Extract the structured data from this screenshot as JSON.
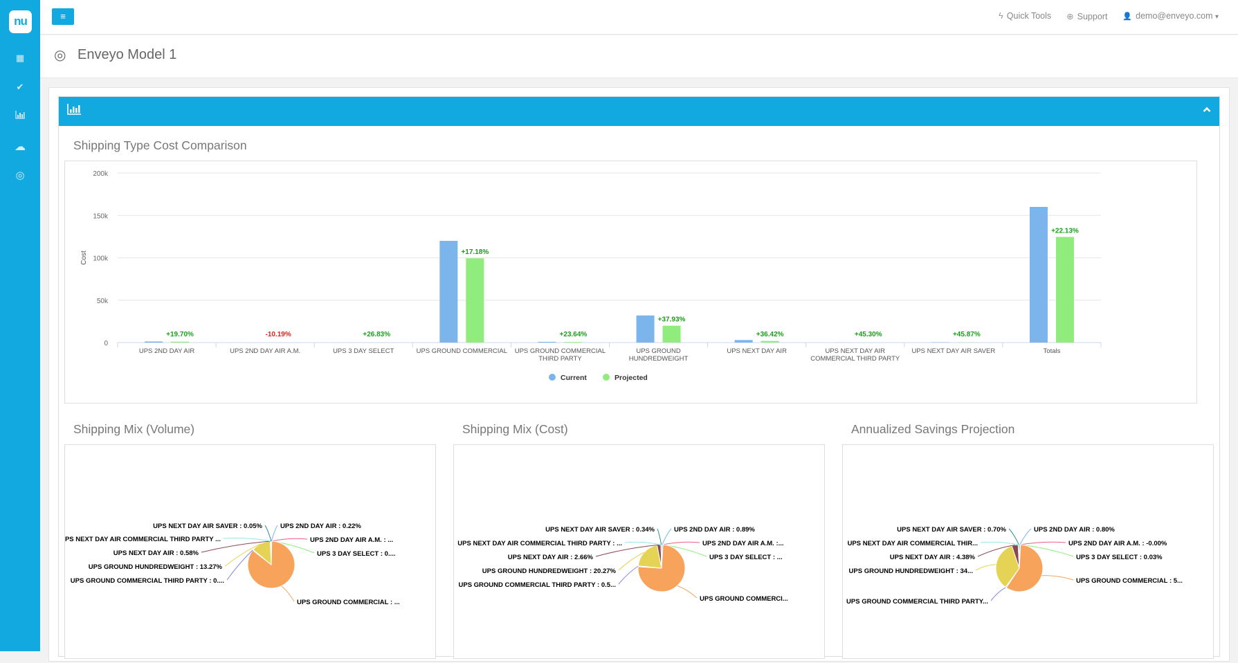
{
  "sidebar": {
    "logo": "nu",
    "items": [
      {
        "name": "dashboard",
        "icon": "grid-icon",
        "glyph": "▦"
      },
      {
        "name": "tasks",
        "icon": "check-icon",
        "glyph": "✔"
      },
      {
        "name": "reports",
        "icon": "bar-chart-icon",
        "glyph": "📊"
      },
      {
        "name": "cloud",
        "icon": "cloud-icon",
        "glyph": "☁"
      },
      {
        "name": "models",
        "icon": "target-icon",
        "glyph": "◎"
      }
    ]
  },
  "topbar": {
    "menu_glyph": "≡",
    "quick_tools": "Quick Tools",
    "support": "Support",
    "user": "demo@enveyo.com",
    "bolt_glyph": "ϟ",
    "support_glyph": "⊕",
    "user_glyph": "👤",
    "caret_glyph": "▾"
  },
  "page": {
    "title": "Enveyo Model 1",
    "title_glyph": "◎"
  },
  "panel": {
    "header_glyph": "📊",
    "collapse_glyph": "⌃"
  },
  "colors": {
    "brand": "#11a9e0",
    "current": "#7cb5ec",
    "projected": "#90ed7d",
    "positive_label": "#1a9e1a",
    "negative_label": "#e02020",
    "pie": [
      "#7cb5ec",
      "#f15c80",
      "#90ed7d",
      "#f7a35c",
      "#8085e9",
      "#e4d354",
      "#8d4653",
      "#91e8e1",
      "#2b908f"
    ]
  },
  "chart_data": [
    {
      "type": "bar",
      "title": "Shipping Type Cost Comparison",
      "xlabel": "",
      "ylabel": "Cost",
      "ylim": [
        0,
        200000
      ],
      "yticks": [
        "0",
        "50k",
        "100k",
        "150k",
        "200k"
      ],
      "grid": true,
      "legend": "bottom-center",
      "categories": [
        [
          "UPS 2ND DAY AIR"
        ],
        [
          "UPS 2ND DAY AIR A.M."
        ],
        [
          "UPS 3 DAY SELECT"
        ],
        [
          "UPS GROUND COMMERCIAL"
        ],
        [
          "UPS GROUND COMMERCIAL",
          "THIRD PARTY"
        ],
        [
          "UPS GROUND",
          "HUNDREDWEIGHT"
        ],
        [
          "UPS NEXT DAY AIR"
        ],
        [
          "UPS NEXT DAY AIR",
          "COMMERCIAL THIRD PARTY"
        ],
        [
          "UPS NEXT DAY AIR SAVER"
        ],
        [
          "Totals"
        ]
      ],
      "series": [
        {
          "name": "Current",
          "values": [
            1300,
            10,
            60,
            120000,
            900,
            32000,
            3000,
            100,
            400,
            160000
          ]
        },
        {
          "name": "Projected",
          "values": [
            1050,
            11,
            45,
            99400,
            690,
            19900,
            1900,
            55,
            220,
            124600
          ]
        }
      ],
      "data_labels": [
        "+19.70%",
        "-10.19%",
        "+26.83%",
        "+17.18%",
        "+23.64%",
        "+37.93%",
        "+36.42%",
        "+45.30%",
        "+45.87%",
        "+22.13%"
      ]
    },
    {
      "type": "pie",
      "title": "Shipping Mix (Volume)",
      "slices": [
        {
          "label": "UPS 2ND DAY AIR : 0.22%",
          "value": 0.22
        },
        {
          "label": "UPS 2ND DAY AIR A.M. : ...",
          "value": 0.02
        },
        {
          "label": "UPS 3 DAY SELECT : 0....",
          "value": 0.1
        },
        {
          "label": "UPS GROUND COMMERCIAL : ...",
          "value": 85.2
        },
        {
          "label": "UPS GROUND COMMERCIAL THIRD PARTY : 0....",
          "value": 0.5
        },
        {
          "label": "UPS GROUND HUNDREDWEIGHT : 13.27%",
          "value": 13.27
        },
        {
          "label": "UPS NEXT DAY AIR : 0.58%",
          "value": 0.58
        },
        {
          "label": "UPS NEXT DAY AIR COMMERCIAL THIRD PARTY ...",
          "value": 0.06
        },
        {
          "label": "UPS NEXT DAY AIR SAVER : 0.05%",
          "value": 0.05
        }
      ]
    },
    {
      "type": "pie",
      "title": "Shipping Mix (Cost)",
      "slices": [
        {
          "label": "UPS 2ND DAY AIR : 0.89%",
          "value": 0.89
        },
        {
          "label": "UPS 2ND DAY AIR A.M. :...",
          "value": 0.01
        },
        {
          "label": "UPS 3 DAY SELECT : ...",
          "value": 0.04
        },
        {
          "label": "UPS GROUND COMMERCI...",
          "value": 74.75
        },
        {
          "label": "UPS GROUND COMMERCIAL THIRD PARTY : 0.5...",
          "value": 0.55
        },
        {
          "label": "UPS GROUND HUNDREDWEIGHT : 20.27%",
          "value": 20.27
        },
        {
          "label": "UPS NEXT DAY AIR : 2.66%",
          "value": 2.66
        },
        {
          "label": "UPS NEXT DAY AIR COMMERCIAL THIRD PARTY : ...",
          "value": 0.06
        },
        {
          "label": "UPS NEXT DAY AIR SAVER : 0.34%",
          "value": 0.34
        }
      ]
    },
    {
      "type": "pie",
      "title": "Annualized Savings Projection",
      "slices": [
        {
          "label": "UPS 2ND DAY AIR : 0.80%",
          "value": 0.8
        },
        {
          "label": "UPS 2ND DAY AIR A.M. : -0.00%",
          "value": 0.0
        },
        {
          "label": "UPS 3 DAY SELECT : 0.03%",
          "value": 0.03
        },
        {
          "label": "UPS GROUND COMMERCIAL : 5...",
          "value": 58.6
        },
        {
          "label": "UPS GROUND COMMERCIAL THIRD PARTY...",
          "value": 0.6
        },
        {
          "label": "UPS GROUND HUNDREDWEIGHT : 34...",
          "value": 34.8
        },
        {
          "label": "UPS NEXT DAY AIR : 4.38%",
          "value": 4.38
        },
        {
          "label": "UPS NEXT DAY AIR COMMERCIAL THIR...",
          "value": 0.1
        },
        {
          "label": "UPS NEXT DAY AIR SAVER : 0.70%",
          "value": 0.7
        }
      ]
    }
  ]
}
